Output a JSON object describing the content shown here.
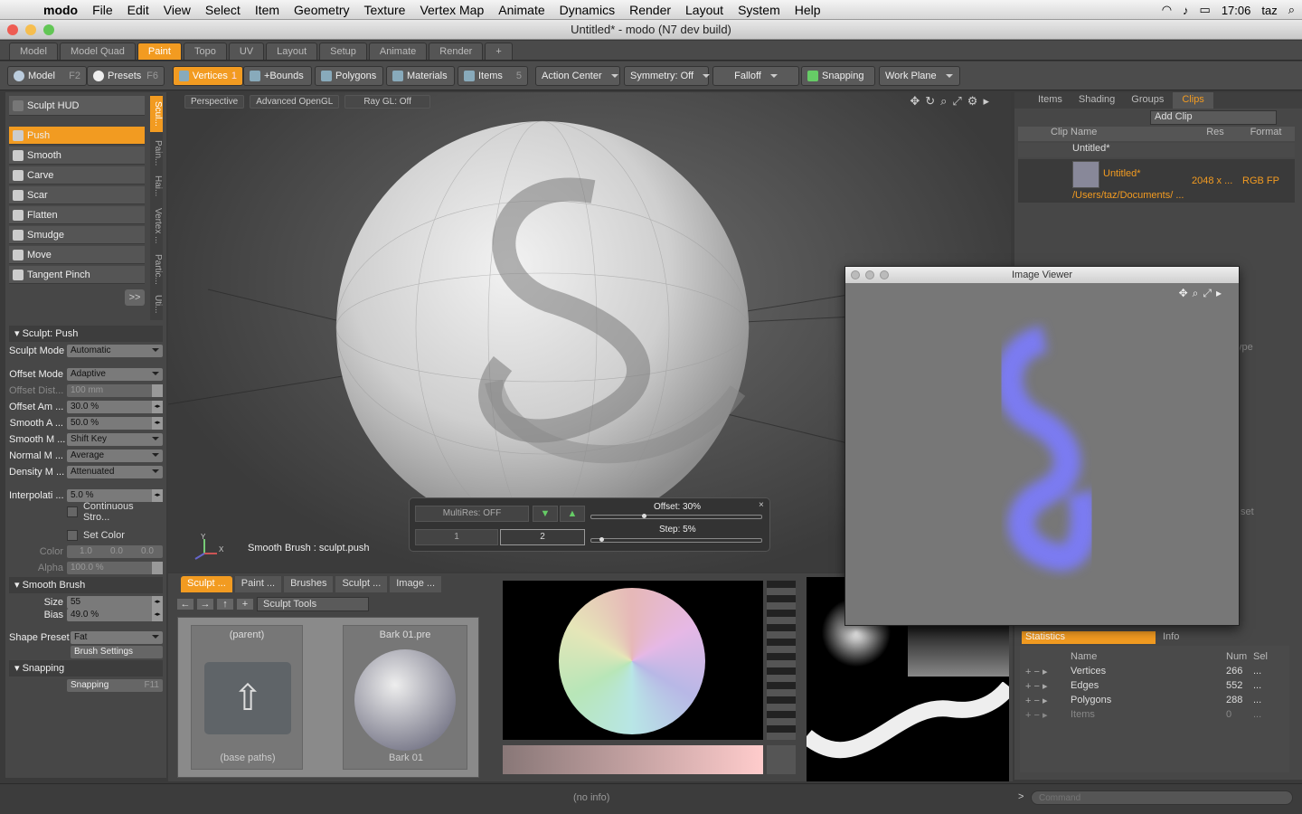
{
  "menubar": {
    "app": "modo",
    "items": [
      "File",
      "Edit",
      "View",
      "Select",
      "Item",
      "Geometry",
      "Texture",
      "Vertex Map",
      "Animate",
      "Dynamics",
      "Render",
      "Layout",
      "System",
      "Help"
    ],
    "time": "17:06",
    "user": "taz"
  },
  "window": {
    "title": "Untitled* - modo (N7 dev build)"
  },
  "layout_tabs": [
    "Model",
    "Model Quad",
    "Paint",
    "Topo",
    "UV",
    "Layout",
    "Setup",
    "Animate",
    "Render"
  ],
  "toolbar": {
    "model": "Model",
    "model_key": "F2",
    "presets": "Presets",
    "presets_key": "F6",
    "vertices": "Vertices",
    "vertices_key": "1",
    "bounds": "+Bounds",
    "polygons": "Polygons",
    "materials": "Materials",
    "items": "Items",
    "items_key": "5",
    "action_center": "Action Center",
    "symmetry": "Symmetry: Off",
    "falloff": "Falloff",
    "snapping": "Snapping",
    "work_plane": "Work Plane"
  },
  "left": {
    "hud": "Sculpt HUD",
    "tools": [
      "Push",
      "Smooth",
      "Carve",
      "Scar",
      "Flatten",
      "Smudge",
      "Move",
      "Tangent Pinch"
    ],
    "more": ">>",
    "vtabs": [
      "Scul...",
      "Pain...",
      "Hai...",
      "Vertex ...",
      "Partic...",
      "Uti..."
    ],
    "sculpt_header": "Sculpt: Push",
    "props": [
      {
        "label": "Sculpt Mode",
        "value": "Automatic",
        "kind": "sel"
      },
      {
        "label": "Offset Mode",
        "value": "Adaptive",
        "kind": "sel"
      },
      {
        "label": "Offset Dist...",
        "value": "100 mm",
        "kind": "num",
        "dim": true
      },
      {
        "label": "Offset Am ...",
        "value": "30.0 %",
        "kind": "num"
      },
      {
        "label": "Smooth A ...",
        "value": "50.0 %",
        "kind": "num"
      },
      {
        "label": "Smooth M ...",
        "value": "Shift Key",
        "kind": "sel"
      },
      {
        "label": "Normal M ...",
        "value": "Average",
        "kind": "sel"
      },
      {
        "label": "Density M ...",
        "value": "Attenuated",
        "kind": "sel"
      }
    ],
    "interpolation": {
      "label": "Interpolati ...",
      "value": "5.0 %"
    },
    "continuous": "Continuous Stro...",
    "set_color": "Set Color",
    "color": {
      "label": "Color",
      "r": "1.0",
      "g": "0.0",
      "b": "0.0"
    },
    "alpha": {
      "label": "Alpha",
      "value": "100.0 %"
    },
    "smooth_brush": "Smooth Brush",
    "size": {
      "label": "Size",
      "value": "55"
    },
    "bias": {
      "label": "Bias",
      "value": "49.0 %"
    },
    "shape_preset": {
      "label": "Shape Preset",
      "value": "Fat"
    },
    "brush_settings": "Brush Settings",
    "snapping_hdr": "Snapping",
    "snapping": "Snapping",
    "snapping_key": "F11"
  },
  "viewport": {
    "perspective": "Perspective",
    "gl": "Advanced OpenGL",
    "raygl": "Ray GL: Off",
    "tool_label": "Smooth Brush : sculpt.push",
    "axis_y": "Y",
    "axis_x": "X"
  },
  "multires": {
    "label": "MultiRes: OFF",
    "offset": "Offset:  30%",
    "step": "Step:   5%",
    "level1": "1",
    "level2": "2",
    "offset_frac": 0.3,
    "step_frac": 0.05
  },
  "bottom": {
    "tabs": [
      "Sculpt ...",
      "Paint ...",
      "Brushes",
      "Sculpt ...",
      "Image ..."
    ],
    "dropdown": "Sculpt Tools",
    "parent": "(parent)",
    "base_paths": "(base paths)",
    "preset_title": "Bark 01.pre",
    "preset_name": "Bark 01"
  },
  "right": {
    "tabs": [
      "Items",
      "Shading",
      "Groups",
      "Clips"
    ],
    "add_clip": "Add Clip",
    "cols": [
      "Clip Name",
      "Res",
      "Format"
    ],
    "root": "Untitled*",
    "clip": {
      "name": "Untitled*",
      "res": "2048 x ...",
      "format": "RGB FP",
      "path": "/Users/taz/Documents/ ..."
    },
    "partial1": "ype",
    "partial2": "set",
    "stats_tabs": [
      "Statistics",
      "Info"
    ],
    "stats_cols": [
      "Name",
      "Num",
      "Sel"
    ],
    "stats": [
      {
        "name": "Vertices",
        "num": "266",
        "sel": "..."
      },
      {
        "name": "Edges",
        "num": "552",
        "sel": "..."
      },
      {
        "name": "Polygons",
        "num": "288",
        "sel": "..."
      },
      {
        "name": "Items",
        "num": "0",
        "sel": "..."
      }
    ]
  },
  "image_viewer": {
    "title": "Image Viewer"
  },
  "status": {
    "info": "(no info)",
    "command": "Command"
  }
}
